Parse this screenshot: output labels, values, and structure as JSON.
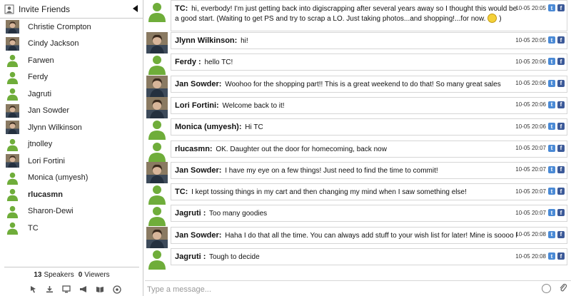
{
  "sidebar": {
    "title": "Invite Friends",
    "users": [
      {
        "name": "Christie Crompton",
        "avatar": "photo",
        "bold": false
      },
      {
        "name": "Cindy Jackson",
        "avatar": "photo",
        "bold": false
      },
      {
        "name": "Farwen",
        "avatar": "default",
        "bold": false
      },
      {
        "name": "Ferdy",
        "avatar": "default",
        "bold": false
      },
      {
        "name": "Jagruti",
        "avatar": "default",
        "bold": false
      },
      {
        "name": "Jan Sowder",
        "avatar": "photo",
        "bold": false
      },
      {
        "name": "Jlynn Wilkinson",
        "avatar": "photo",
        "bold": false
      },
      {
        "name": "jtnolley",
        "avatar": "default",
        "bold": false
      },
      {
        "name": "Lori Fortini",
        "avatar": "photo",
        "bold": false
      },
      {
        "name": "Monica (umyesh)",
        "avatar": "default",
        "bold": false
      },
      {
        "name": "rlucasmn",
        "avatar": "default",
        "bold": true
      },
      {
        "name": "Sharon-Dewi",
        "avatar": "default",
        "bold": false
      },
      {
        "name": "TC",
        "avatar": "default",
        "bold": false
      }
    ],
    "counts": {
      "speakers": "13",
      "speakers_label": "Speakers",
      "viewers": "0",
      "viewers_label": "Viewers"
    },
    "toolbar_icons": [
      "pointer-icon",
      "download-icon",
      "screen-icon",
      "megaphone-icon",
      "book-icon",
      "help-icon"
    ]
  },
  "messages": [
    {
      "author": "TC:",
      "text": "hi, everbody! I'm just getting back into digiscrapping after several years away so I thought this would be a good start. (Waiting to get PS and try to scrap a LO. Just taking photos...and shopping!...for now.",
      "time": "10-05 20:05",
      "avatar": "default",
      "tall": true,
      "smiley": true
    },
    {
      "author": "Jlynn Wilkinson:",
      "text": "hi!",
      "time": "10-05 20:05",
      "avatar": "photo"
    },
    {
      "author": "Ferdy :",
      "text": "hello TC!",
      "time": "10-05 20:06",
      "avatar": "default"
    },
    {
      "author": "Jan Sowder:",
      "text": "Woohoo for the shopping part!! This is a great weekend to do that! So many great sales",
      "time": "10-05 20:06",
      "avatar": "photo"
    },
    {
      "author": "Lori Fortini:",
      "text": "Welcome back to it!",
      "time": "10-05 20:06",
      "avatar": "photo"
    },
    {
      "author": "Monica (umyesh):",
      "text": "Hi TC",
      "time": "10-05 20:06",
      "avatar": "default"
    },
    {
      "author": "rlucasmn:",
      "text": "OK. Daughter out the door for homecoming, back now",
      "time": "10-05 20:07",
      "avatar": "default"
    },
    {
      "author": "Jan Sowder:",
      "text": "I have my eye on a few things! Just need to find the time to commit!",
      "time": "10-05 20:07",
      "avatar": "photo"
    },
    {
      "author": "TC:",
      "text": "I kept tossing things in my cart and then changing my mind when I saw something else!",
      "time": "10-05 20:07",
      "avatar": "default"
    },
    {
      "author": "Jagruti :",
      "text": "Too many goodies",
      "time": "10-05 20:07",
      "avatar": "default"
    },
    {
      "author": "Jan Sowder:",
      "text": "Haha I do that all the time. You can always add stuff to your wish list for later! Mine is soooo long",
      "time": "10-05 20:08",
      "avatar": "photo"
    },
    {
      "author": "Jagruti :",
      "text": "Tough to decide",
      "time": "10-05 20:08",
      "avatar": "default"
    }
  ],
  "input": {
    "placeholder": "Type a message..."
  },
  "colors": {
    "default_avatar": "#6fad3a",
    "twitter": "#4a8ad6",
    "facebook": "#3b5998"
  }
}
